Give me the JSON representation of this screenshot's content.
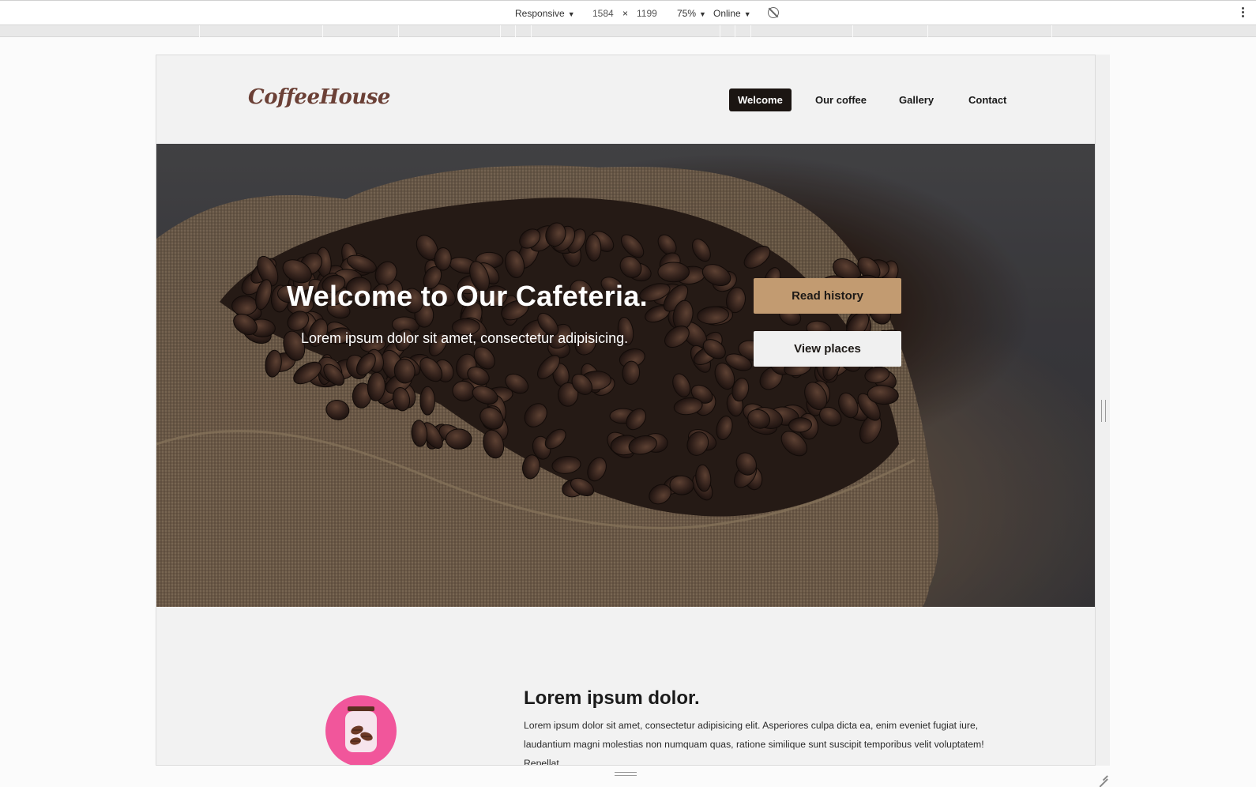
{
  "devtools": {
    "device_mode": "Responsive",
    "width": "1584",
    "times": "×",
    "height": "1199",
    "zoom": "75%",
    "network": "Online"
  },
  "site": {
    "logo": "CoffeeHouse",
    "nav": [
      {
        "label": "Welcome",
        "active": true
      },
      {
        "label": "Our coffee",
        "active": false
      },
      {
        "label": "Gallery",
        "active": false
      },
      {
        "label": "Contact",
        "active": false
      }
    ]
  },
  "hero": {
    "title": "Welcome to Our Cafeteria.",
    "subtitle": "Lorem ipsum dolor sit amet, consectetur adipisicing.",
    "primary_button": "Read history",
    "secondary_button": "View places"
  },
  "section": {
    "title": "Lorem ipsum dolor.",
    "text": "Lorem ipsum dolor sit amet, consectetur adipisicing elit. Asperiores culpa dicta ea, enim eveniet fugiat iure, laudantium magni molestias non numquam quas, ratione similique sunt suscipit temporibus velit voluptatem! Repellat."
  },
  "colors": {
    "brand_brown": "#6b4036",
    "accent_tan": "#c29b71",
    "nav_active_bg": "#1b1512",
    "icon_pink": "#f1569b"
  }
}
